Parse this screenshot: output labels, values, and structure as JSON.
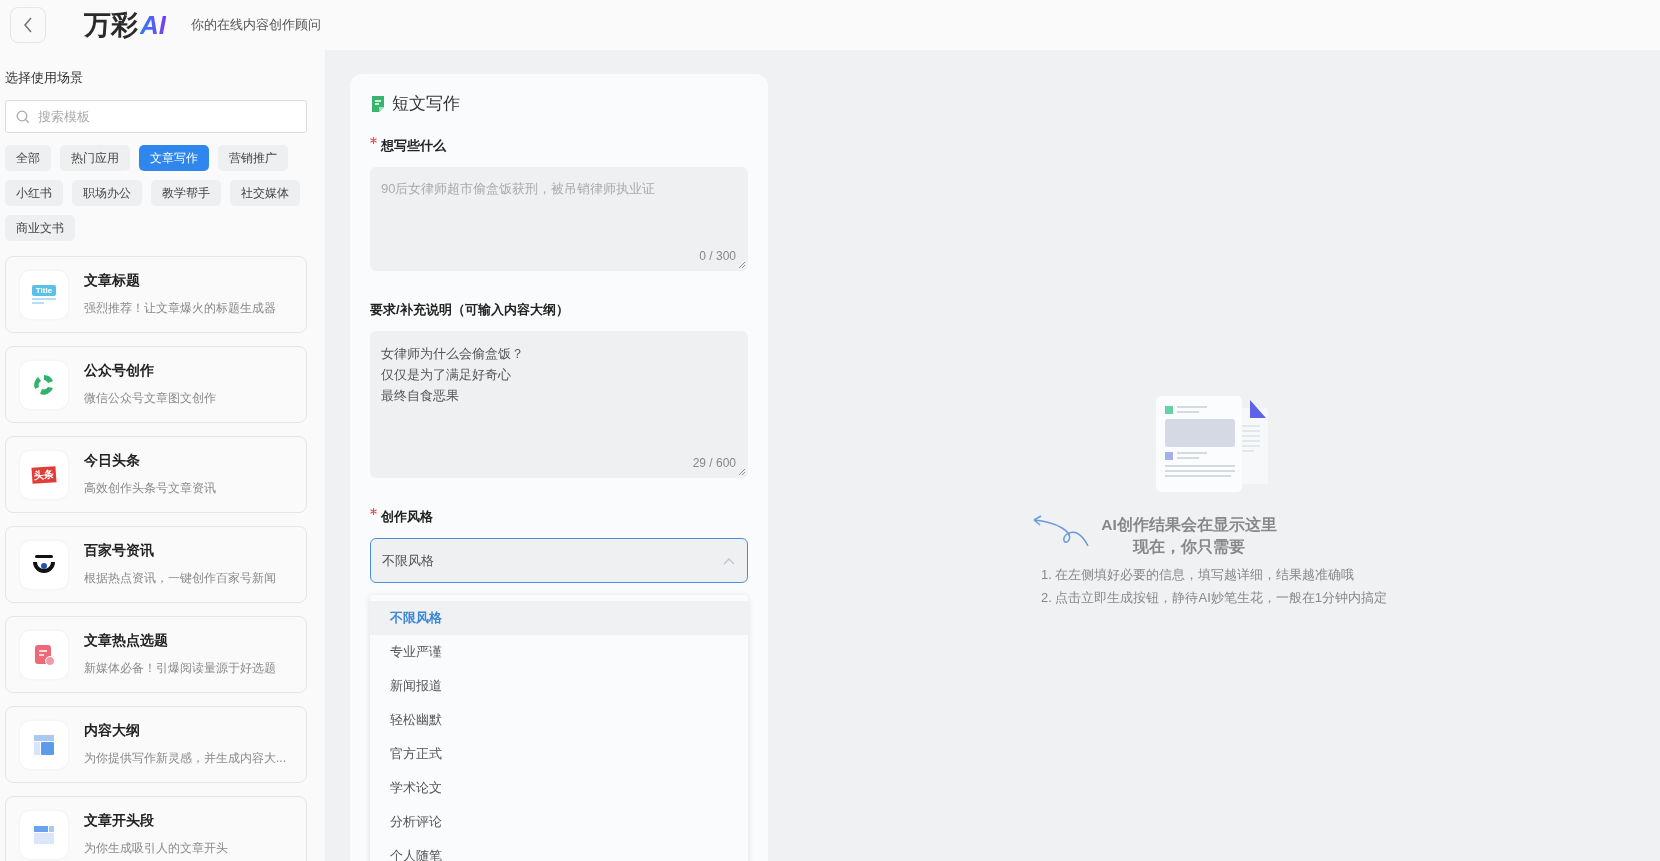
{
  "header": {
    "logo": {
      "text": "万彩",
      "mark": "AI"
    },
    "tagline": "你的在线内容创作顾问"
  },
  "sidebar": {
    "title": "选择使用场景",
    "search": {
      "placeholder": "搜索模板"
    },
    "tags": [
      {
        "label": "全部",
        "selected": false
      },
      {
        "label": "热门应用",
        "selected": false
      },
      {
        "label": "文章写作",
        "selected": true
      },
      {
        "label": "营销推广",
        "selected": false
      },
      {
        "label": "小红书",
        "selected": false
      },
      {
        "label": "职场办公",
        "selected": false
      },
      {
        "label": "教学帮手",
        "selected": false
      },
      {
        "label": "社交媒体",
        "selected": false
      },
      {
        "label": "商业文书",
        "selected": false
      }
    ],
    "templates": [
      {
        "kind": "title",
        "icon_text": "Title",
        "name": "文章标题",
        "desc": "强烈推荐！让文章爆火的标题生成器"
      },
      {
        "kind": "recycle",
        "name": "公众号创作",
        "desc": "微信公众号文章图文创作"
      },
      {
        "kind": "stamp",
        "icon_text": "头条",
        "name": "今日头条",
        "desc": "高效创作头条号文章资讯"
      },
      {
        "kind": "eye",
        "name": "百家号资讯",
        "desc": "根据热点资讯，一键创作百家号新闻"
      },
      {
        "kind": "note",
        "name": "文章热点选题",
        "desc": "新媒体必备！引爆阅读量源于好选题"
      },
      {
        "kind": "outline",
        "name": "内容大纲",
        "desc": "为你提供写作新灵感，并生成内容大..."
      },
      {
        "kind": "layout",
        "name": "文章开头段",
        "desc": "为你生成吸引人的文章开头"
      }
    ]
  },
  "form": {
    "title": "短文写作",
    "fields": [
      {
        "kind": "textarea",
        "label": "想写些什么",
        "required": true,
        "placeholder": "90后女律师超市偷盒饭获刑，被吊销律师执业证",
        "counter": "0 / 300"
      },
      {
        "kind": "textarea",
        "label": "要求/补充说明（可输入内容大纲）",
        "required": false,
        "lines": [
          "女律师为什么会偷盒饭？",
          "仅仅是为了满足好奇心",
          "最终自食恶果"
        ],
        "counter": "29 / 600"
      },
      {
        "kind": "select",
        "label": "创作风格",
        "required": true,
        "value": "不限风格",
        "expanded": true,
        "options": [
          {
            "label": "不限风格",
            "selected": true
          },
          {
            "label": "专业严谨",
            "selected": false
          },
          {
            "label": "新闻报道",
            "selected": false
          },
          {
            "label": "轻松幽默",
            "selected": false
          },
          {
            "label": "官方正式",
            "selected": false
          },
          {
            "label": "学术论文",
            "selected": false
          },
          {
            "label": "分析评论",
            "selected": false
          },
          {
            "label": "个人随笔",
            "selected": false
          }
        ]
      }
    ]
  },
  "result": {
    "heading": [
      "AI创作结果会在显示这里",
      "现在，你只需要"
    ],
    "steps": [
      "1. 在左侧填好必要的信息，填写越详细，结果越准确哦",
      "2. 点击立即生成按钮，静待AI妙笔生花，一般在1分钟内搞定"
    ]
  }
}
